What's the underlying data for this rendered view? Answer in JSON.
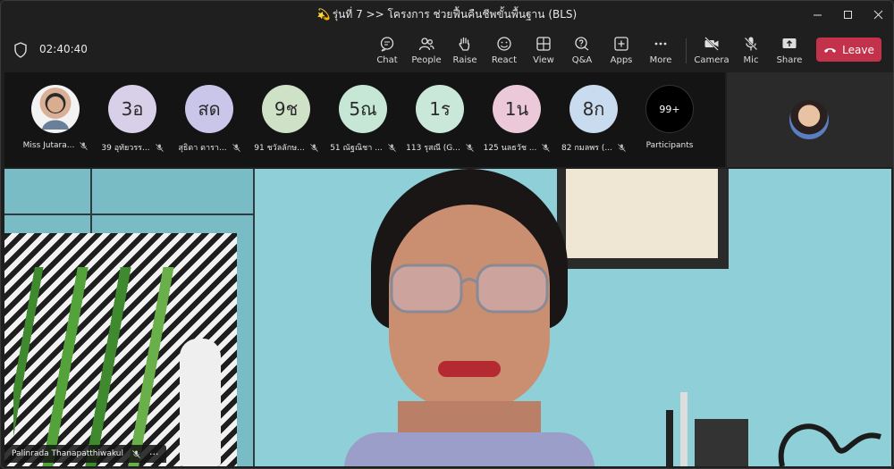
{
  "window": {
    "title_icon": "💫",
    "title": "รุ่นที่ 7 >> โครงการ ช่วยฟื้นคืนชีพขั้นพื้นฐาน (BLS)",
    "controls": [
      "minimize",
      "maximize",
      "close"
    ]
  },
  "meeting": {
    "timer": "02:40:40"
  },
  "toolbar": {
    "items": [
      {
        "label": "Chat",
        "icon": "chat-icon"
      },
      {
        "label": "People",
        "icon": "people-icon"
      },
      {
        "label": "Raise",
        "icon": "raise-hand-icon"
      },
      {
        "label": "React",
        "icon": "smile-icon"
      },
      {
        "label": "View",
        "icon": "grid-icon"
      },
      {
        "label": "Q&A",
        "icon": "qa-icon"
      },
      {
        "label": "Apps",
        "icon": "plus-square-icon"
      },
      {
        "label": "More",
        "icon": "more-icon"
      },
      {
        "label": "Camera",
        "icon": "camera-off-icon"
      },
      {
        "label": "Mic",
        "icon": "mic-off-icon"
      },
      {
        "label": "Share",
        "icon": "share-icon"
      }
    ],
    "leave_label": "Leave"
  },
  "participants": [
    {
      "initials": "",
      "name": "Miss Jutara...",
      "color": "#ffffff",
      "photo": true
    },
    {
      "initials": "3อ",
      "name": "39 อุทัยวรร...",
      "color": "#d8cfe8"
    },
    {
      "initials": "สด",
      "name": "สุธิดา ดารา...",
      "color": "#c9c6ea"
    },
    {
      "initials": "9ช",
      "name": "91 ชวัลลักษ...",
      "color": "#cfe2c8"
    },
    {
      "initials": "5ณ",
      "name": "51 ณัฐณิชา ...",
      "color": "#c6e6d6"
    },
    {
      "initials": "1ร",
      "name": "113 รุสณี (G...",
      "color": "#c9e8da"
    },
    {
      "initials": "1น",
      "name": "125 นลธวัช ...",
      "color": "#ecc9d9"
    },
    {
      "initials": "8ก",
      "name": "82 กมลพร (...",
      "color": "#c9dbee"
    },
    {
      "initials": "99+",
      "name": "Participants",
      "color": "#000000",
      "more": true
    }
  ],
  "speaker": {
    "name": "Palinrada Thanapatthiwakul",
    "more": "···"
  }
}
